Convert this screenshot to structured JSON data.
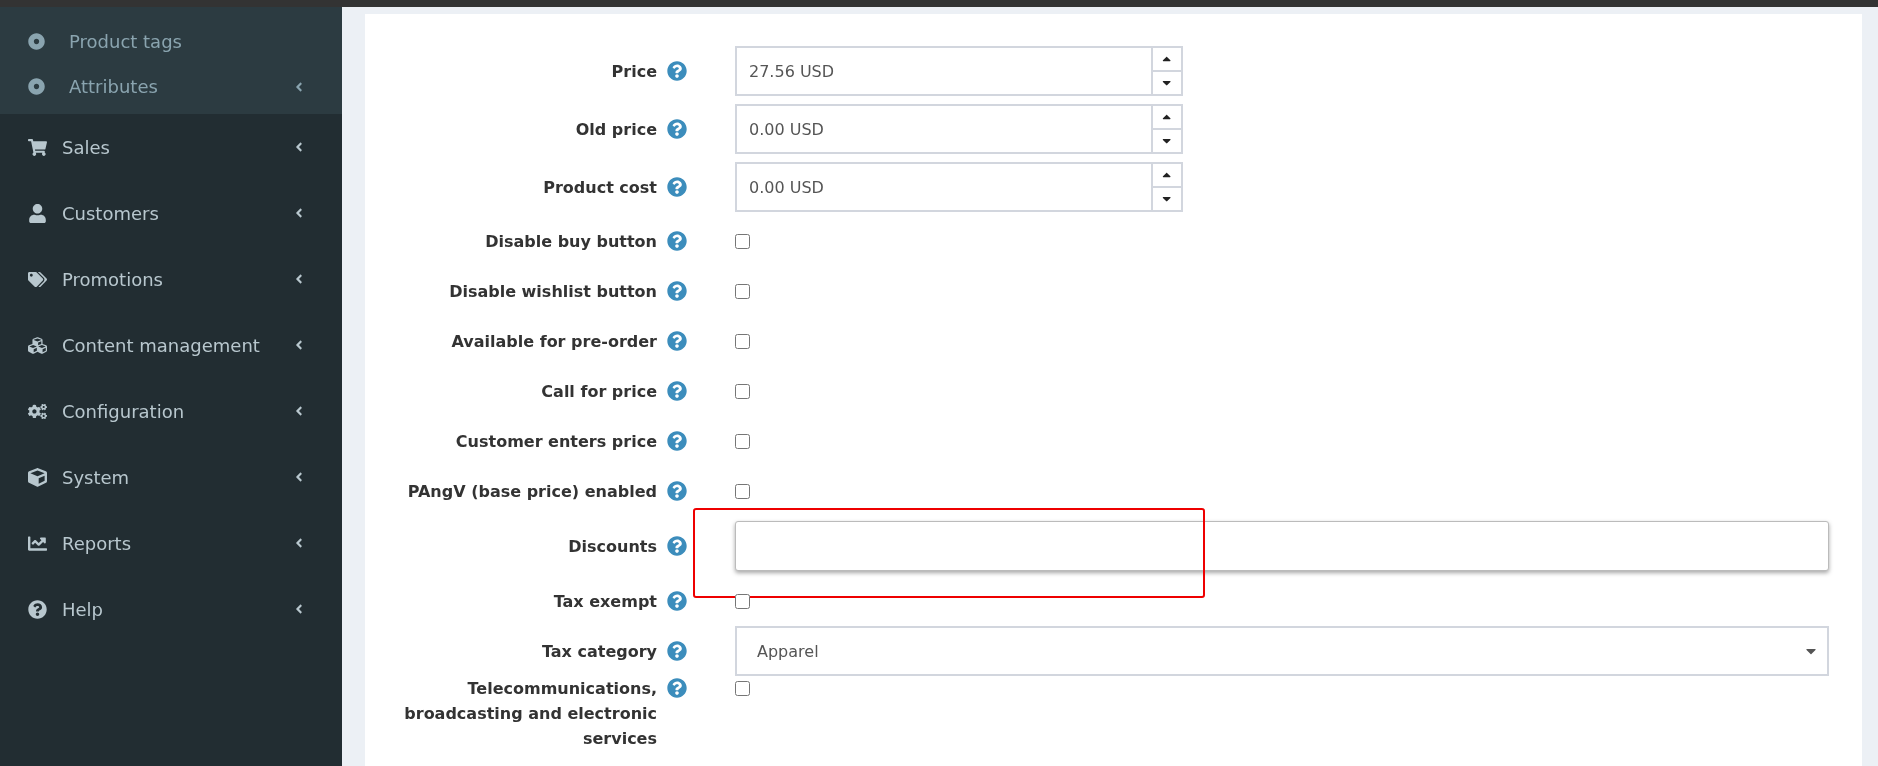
{
  "sidebar": {
    "subitems": [
      {
        "label": "Product tags",
        "has_arrow": false
      },
      {
        "label": "Attributes",
        "has_arrow": true
      }
    ],
    "items": [
      {
        "label": "Sales"
      },
      {
        "label": "Customers"
      },
      {
        "label": "Promotions"
      },
      {
        "label": "Content management"
      },
      {
        "label": "Configuration"
      },
      {
        "label": "System"
      },
      {
        "label": "Reports"
      },
      {
        "label": "Help"
      }
    ]
  },
  "form": {
    "rows": [
      {
        "label": "Price",
        "kind": "number",
        "value": "27.56 USD",
        "highlighted": false
      },
      {
        "label": "Old price",
        "kind": "number",
        "value": "0.00 USD",
        "highlighted": false
      },
      {
        "label": "Product cost",
        "kind": "number",
        "value": "0.00 USD",
        "highlighted": false
      },
      {
        "label": "Disable buy button",
        "kind": "checkbox",
        "checked": false,
        "highlighted": false
      },
      {
        "label": "Disable wishlist button",
        "kind": "checkbox",
        "checked": false,
        "highlighted": false
      },
      {
        "label": "Available for pre-order",
        "kind": "checkbox",
        "checked": false,
        "highlighted": false
      },
      {
        "label": "Call for price",
        "kind": "checkbox",
        "checked": false,
        "highlighted": false
      },
      {
        "label": "Customer enters price",
        "kind": "checkbox",
        "checked": false,
        "highlighted": false
      },
      {
        "label": "PAngV (base price) enabled",
        "kind": "checkbox",
        "checked": false,
        "highlighted": false
      },
      {
        "label": "Discounts",
        "kind": "text",
        "focused": true,
        "highlighted": true
      },
      {
        "label": "Tax exempt",
        "kind": "checkbox",
        "checked": false,
        "highlighted": false
      },
      {
        "label": "Tax category",
        "kind": "select",
        "value": "Apparel",
        "highlighted": false
      },
      {
        "label": "Telecommunications, broadcasting and electronic services",
        "kind": "checkbox",
        "checked": false,
        "highlighted": false
      }
    ]
  }
}
